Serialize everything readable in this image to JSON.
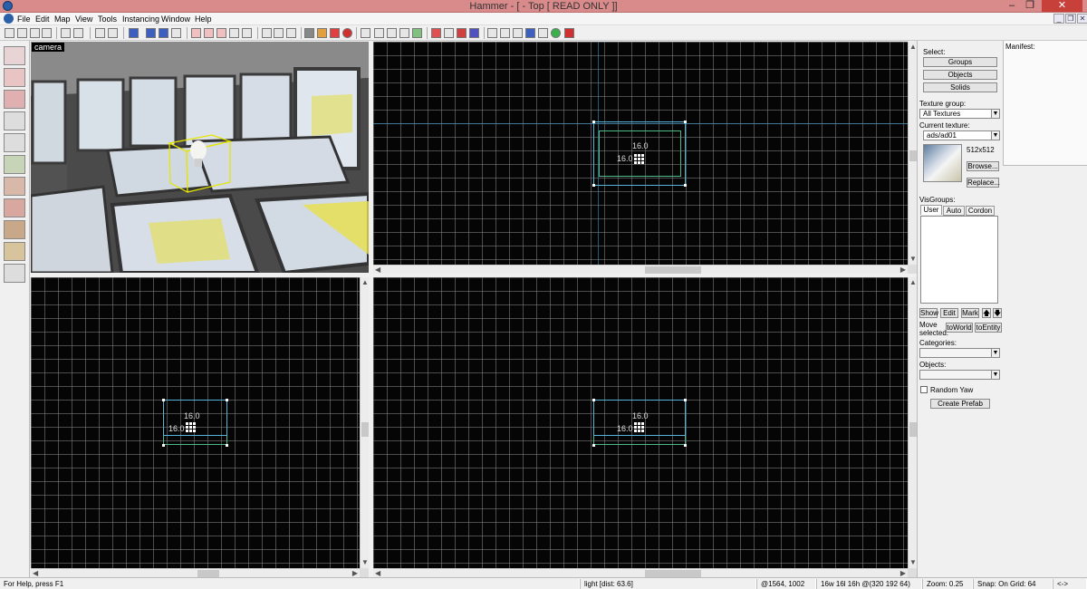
{
  "window": {
    "title": "Hammer - [ - Top [ READ ONLY ]]",
    "minimize_glyph": "–",
    "restore_glyph": "❐",
    "close_glyph": "✕"
  },
  "mdi": {
    "minimize_glyph": "_",
    "restore_glyph": "❐",
    "close_glyph": "✕"
  },
  "menu": [
    {
      "label": "File"
    },
    {
      "label": "Edit"
    },
    {
      "label": "Map"
    },
    {
      "label": "View"
    },
    {
      "label": "Tools"
    },
    {
      "label": "Instancing"
    },
    {
      "label": "Window"
    },
    {
      "label": "Help"
    }
  ],
  "camera_view": {
    "label": "camera"
  },
  "viewports": {
    "top": {
      "dim_w": "16.0",
      "dim_h": "16.0"
    },
    "front": {
      "dim_w": "16.0",
      "dim_h": "16.0"
    },
    "side": {
      "dim_w": "16.0",
      "dim_h": "16.0"
    }
  },
  "panel": {
    "select_label": "Select:",
    "groups_btn": "Groups",
    "objects_btn": "Objects",
    "solids_btn": "Solids",
    "texture_group_label": "Texture group:",
    "texture_group_value": "All Textures",
    "current_texture_label": "Current texture:",
    "current_texture_value": "ads/ad01",
    "texture_size": "512x512",
    "browse_btn": "Browse...",
    "replace_btn": "Replace...",
    "visgroups_label": "VisGroups:",
    "tabs": [
      {
        "label": "User"
      },
      {
        "label": "Auto"
      },
      {
        "label": "Cordon"
      }
    ],
    "show_btn": "Show",
    "edit_btn": "Edit",
    "mark_btn": "Mark",
    "up_btn": "🡅",
    "down_btn": "🡇",
    "move_selected_label": "Move selected:",
    "to_world_btn": "toWorld",
    "to_entity_btn": "toEntity",
    "categories_label": "Categories:",
    "objects_label": "Objects:",
    "random_yaw_label": "Random Yaw",
    "create_prefab_btn": "Create Prefab"
  },
  "manifest": {
    "label": "Manifest:"
  },
  "status": {
    "help": "For Help, press F1",
    "selection": "light  [dist: 63.6]",
    "coords": "@1564, 1002",
    "size": "16w 16l 16h @(320 192 64)",
    "zoom": "Zoom: 0.25",
    "snap": "Snap: On Grid: 64",
    "nav": "<->"
  }
}
